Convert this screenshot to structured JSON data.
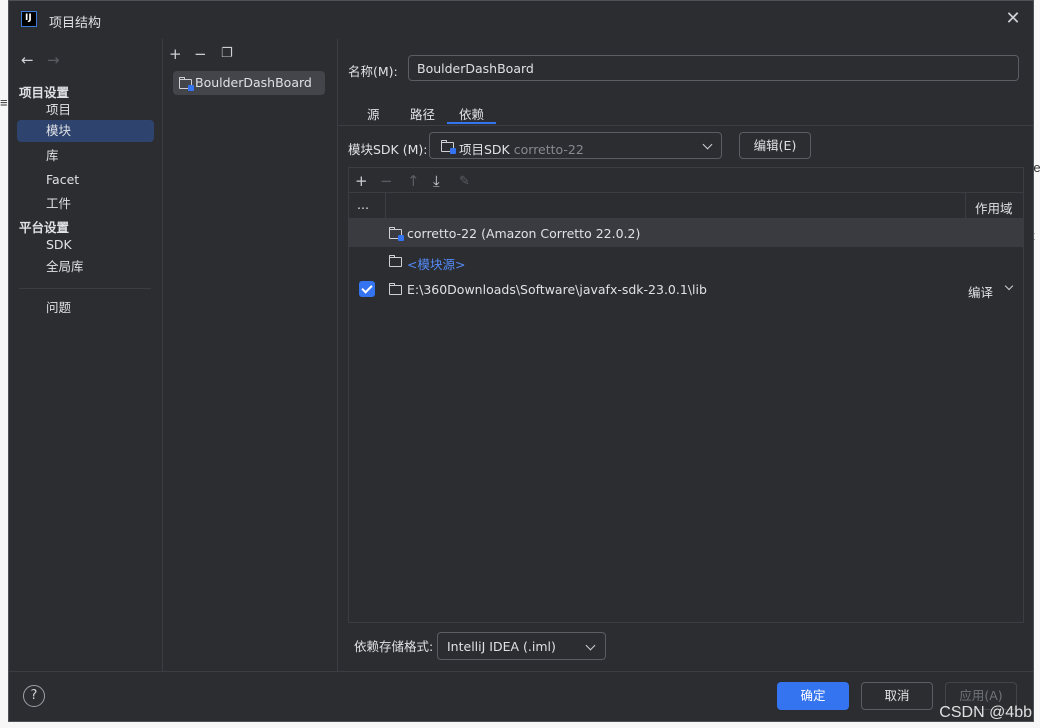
{
  "window": {
    "title": "项目结构"
  },
  "nav": {
    "sections": [
      {
        "label": "项目设置",
        "items": [
          "项目",
          "模块",
          "库",
          "Facet",
          "工件"
        ]
      },
      {
        "label": "平台设置",
        "items": [
          "SDK",
          "全局库"
        ]
      }
    ],
    "selected": "模块",
    "problems": "问题"
  },
  "modules": {
    "items": [
      {
        "name": "BoulderDashBoard"
      }
    ]
  },
  "module": {
    "name_label": "名称(M):",
    "name_value": "BoulderDashBoard",
    "tabs": [
      "源",
      "路径",
      "依赖"
    ],
    "active_tab": "依赖",
    "sdk_label": "模块SDK (M):",
    "sdk_value": "项目SDK",
    "sdk_hint": "corretto-22",
    "edit_button": "编辑(E)",
    "deps_header": {
      "col1": "...",
      "scope": "作用域"
    },
    "dependencies": [
      {
        "label": "corretto-22 (Amazon Corretto 22.0.2)",
        "selected": true
      },
      {
        "label": "<模块源>",
        "link": true
      },
      {
        "label": "E:\\360Downloads\\Software\\javafx-sdk-23.0.1\\lib",
        "checked": true,
        "scope": "编译"
      }
    ],
    "format_label": "依赖存储格式:",
    "format_value": "IntelliJ IDEA (.iml)"
  },
  "footer": {
    "help": "?",
    "ok": "确定",
    "cancel": "取消",
    "apply": "应用(A)"
  },
  "watermark": "CSDN @4bb"
}
